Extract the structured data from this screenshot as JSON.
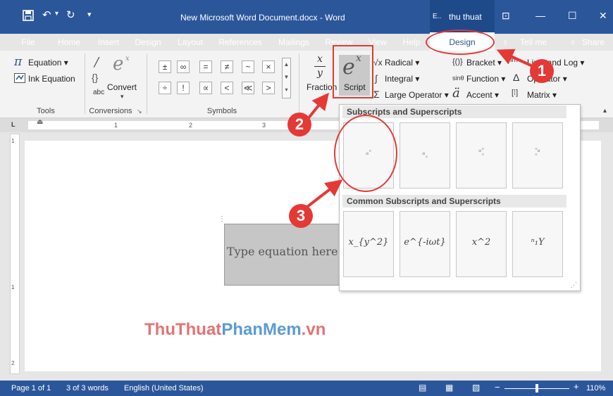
{
  "titlebar": {
    "doc_title": "New Microsoft Word Document.docx - Word",
    "account": "thu thuat"
  },
  "menu": {
    "tabs": [
      "File",
      "Home",
      "Insert",
      "Design",
      "Layout",
      "References",
      "Mailings",
      "Review",
      "View",
      "Help"
    ],
    "active_tab": "Design",
    "tell_me": "Tell me",
    "share": "Share"
  },
  "ribbon": {
    "tools": {
      "equation": "Equation",
      "ink": "Ink Equation",
      "label": "Tools"
    },
    "conversions": {
      "convert": "Convert",
      "abc": "abc",
      "label": "Conversions"
    },
    "symbols": {
      "row1": [
        "±",
        "∞",
        "=",
        "≠",
        "~",
        "×"
      ],
      "row2": [
        "÷",
        "!",
        "∝",
        "<",
        "≪",
        ">"
      ],
      "label": "Symbols"
    },
    "structures": {
      "fraction": "Fraction",
      "script": "Script",
      "radical": "Radical",
      "integral": "Integral",
      "large_operator": "Large Operator",
      "bracket": "Bracket",
      "function": "Function",
      "accent": "Accent",
      "limit_log": "Limit and Log",
      "operator": "Operator",
      "matrix": "Matrix"
    }
  },
  "dropdown": {
    "section1": "Subscripts and Superscripts",
    "section2": "Common Subscripts and Superscripts",
    "common": [
      "x_{y^2}",
      "e^{-iωt}",
      "x^2",
      "ⁿ₁Y"
    ]
  },
  "document": {
    "equation_placeholder": "Type equation here"
  },
  "ruler": {
    "marks": [
      "1",
      "2",
      "3"
    ]
  },
  "status": {
    "page": "Page 1 of 1",
    "words": "3 of 3 words",
    "language": "English (United States)",
    "zoom": "110%"
  },
  "annotations": [
    "1",
    "2",
    "3"
  ],
  "watermark": {
    "part1": "ThuThuat",
    "part2": "PhanMem",
    "part3": ".vn"
  },
  "colors": {
    "accent": "#2b579a",
    "annotation": "#e53935"
  }
}
